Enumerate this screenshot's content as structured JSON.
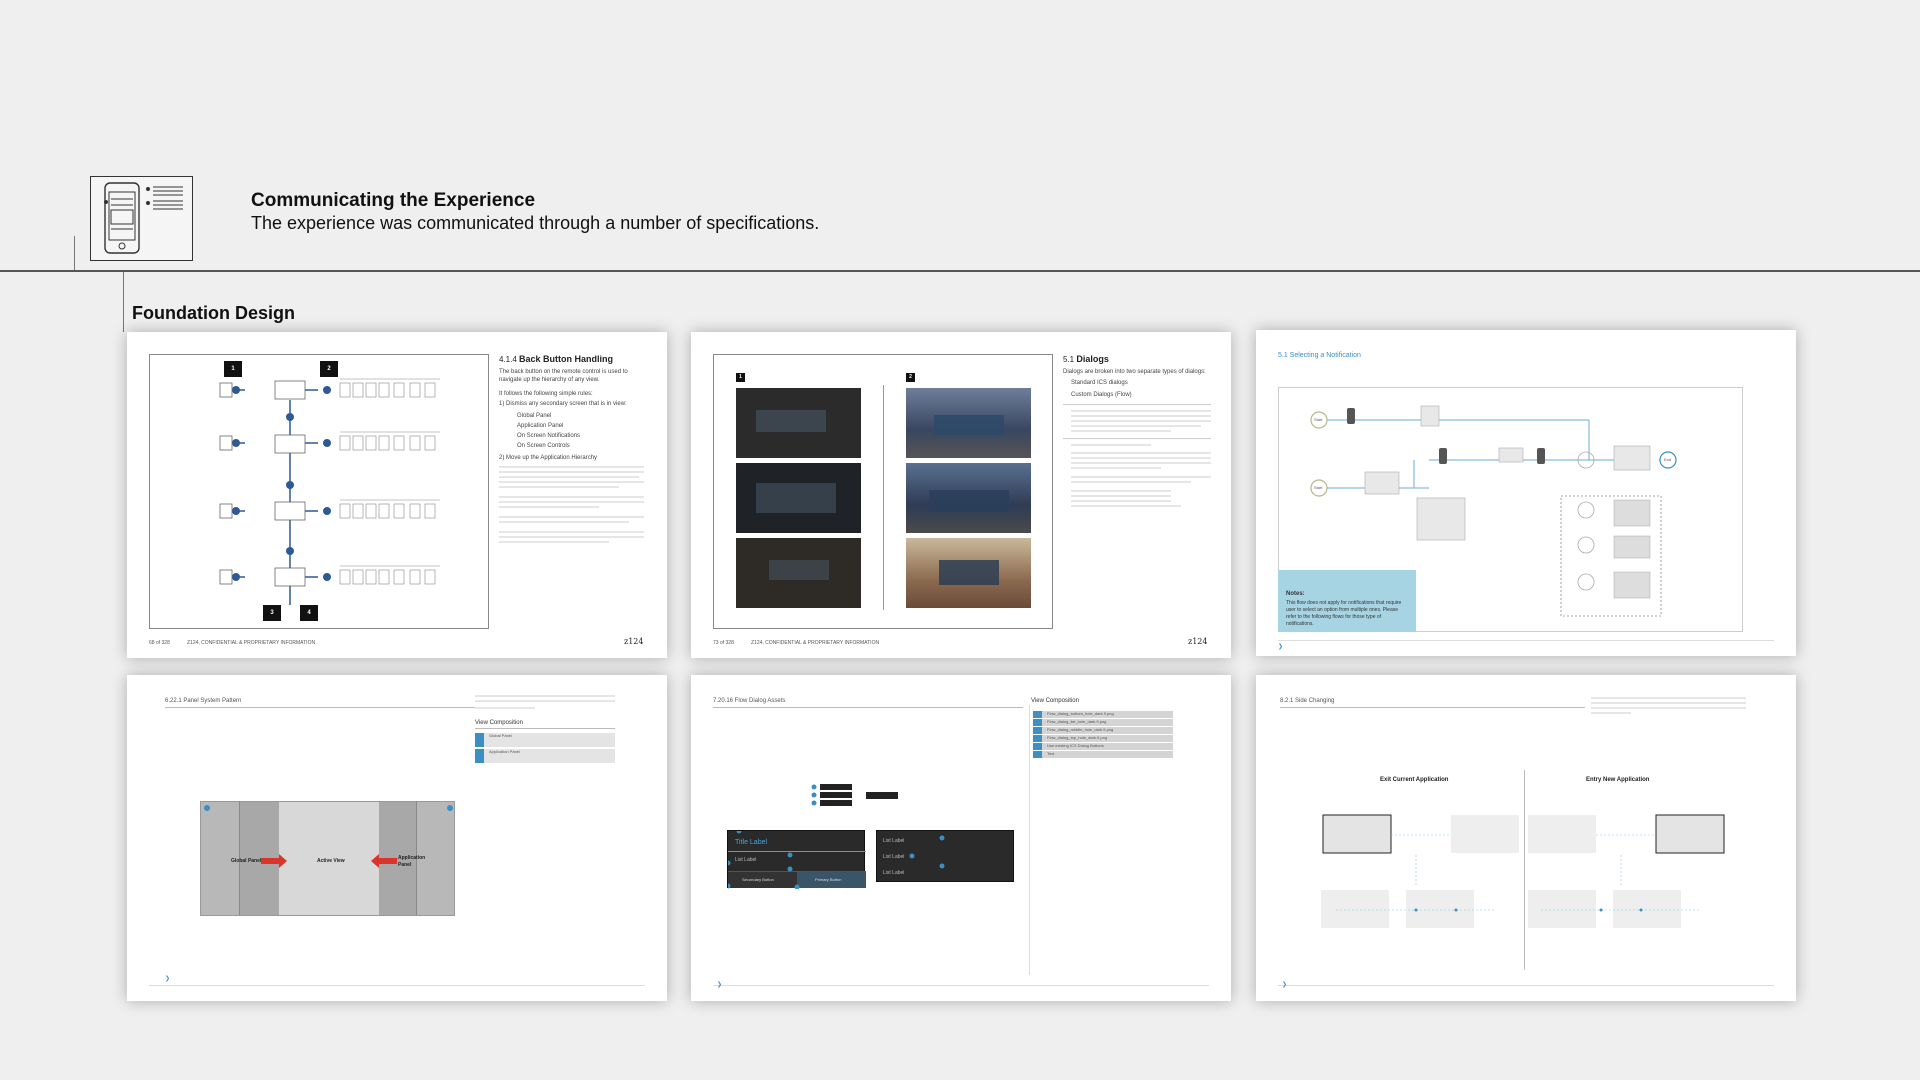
{
  "header": {
    "title": "Communicating the Experience",
    "subtitle": "The experience was communicated through a number of specifications."
  },
  "section": {
    "title": "Foundation Design"
  },
  "pages": {
    "p1": {
      "section_num": "4.1.4",
      "title": "Back Button Handling",
      "markers": [
        "1",
        "2",
        "3",
        "4"
      ],
      "intro": "The back button on the remote control is used to navigate up the hierarchy of any view.",
      "rules_lead": "It follows the following simple rules:",
      "rule1": "1) Dismiss any secondary screen that is in view:",
      "items": [
        "Global Panel",
        "Application Panel",
        "On Screen Notifications",
        "On Screen Controls"
      ],
      "rule2": "2) Move up the Application Hierarchy",
      "footer_left": "68 of 328",
      "footer_mid": "Z124, CONFIDENTIAL & PROPRIETARY INFORMATION",
      "page_mark": "z124"
    },
    "p2": {
      "section_num": "5.1",
      "title": "Dialogs",
      "intro": "Dialogs are broken into two separate types of dialogs:",
      "bullets": [
        "Standard ICS dialogs",
        "Custom Dialogs (Flow)"
      ],
      "markers": [
        "1",
        "2"
      ],
      "footer_left": "73 of 328",
      "footer_mid": "Z124, CONFIDENTIAL & PROPRIETARY INFORMATION",
      "page_mark": "z124"
    },
    "p3": {
      "title": "5.1 Selecting a Notification",
      "start_label": "Start",
      "end_label": "End",
      "notes_title": "Notes:",
      "notes_text": "This flow does not apply for notifications that require user to select an option from multiple ones. Please refer to the following flows for those type of notifications."
    },
    "p4": {
      "title": "6.22.1 Panel System Pattern",
      "view_comp": "View Composition",
      "rows": [
        "Global Panel",
        "Application Panel"
      ],
      "labels": {
        "left": "Global Panel",
        "center": "Active View",
        "right": "Application Panel"
      }
    },
    "p5": {
      "title": "7.20.16 Flow Dialog Assets",
      "view_comp": "View Composition",
      "list": [
        "Flow_dialog_bottom_hole_dark.9.png",
        "Flow_dialog_list_hole_dark.9.png",
        "Flow_dialog_middle_hole_dark.9.png",
        "Flow_dialog_top_hole_dark.9.png",
        "Use existing ICS Dialog Buttons",
        "Text"
      ],
      "dialog": {
        "title": "Title Label",
        "list_label": "List Label",
        "secondary": "Secondary Button",
        "primary": "Primary Button"
      },
      "list_labels": [
        "List Label",
        "List Label",
        "List Label"
      ]
    },
    "p6": {
      "title": "8.2.1 Side Changing",
      "exit": "Exit Current Application",
      "entry": "Entry New Application"
    }
  }
}
